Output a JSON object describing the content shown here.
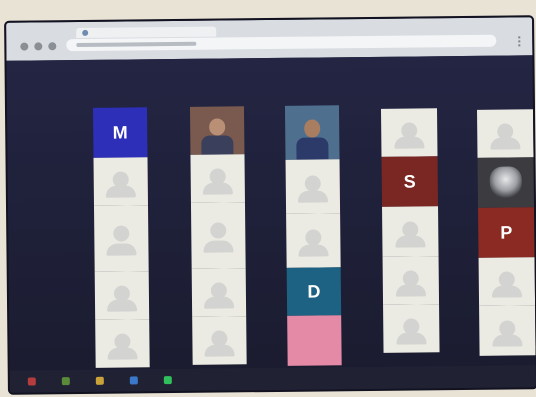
{
  "browser": {
    "tab_icon": "globe-icon",
    "menu_icon": "kebab-menu-icon"
  },
  "meeting": {
    "columns": [
      {
        "id": "col1",
        "tiles": [
          {
            "kind": "initial",
            "label": "M",
            "color": "#2d2fb8"
          },
          {
            "kind": "blank",
            "icon": "person-icon"
          },
          {
            "kind": "blank",
            "icon": "person-icon"
          },
          {
            "kind": "blank",
            "icon": "person-icon"
          },
          {
            "kind": "blank",
            "icon": "person-icon"
          }
        ]
      },
      {
        "id": "col2",
        "tiles": [
          {
            "kind": "photo",
            "icon": "participant-video"
          },
          {
            "kind": "blank",
            "icon": "person-icon"
          },
          {
            "kind": "blank",
            "icon": "person-icon"
          },
          {
            "kind": "blank",
            "icon": "person-icon"
          },
          {
            "kind": "blank",
            "icon": "person-icon"
          }
        ]
      },
      {
        "id": "col3",
        "tiles": [
          {
            "kind": "photo",
            "icon": "participant-video"
          },
          {
            "kind": "blank",
            "icon": "person-icon"
          },
          {
            "kind": "blank",
            "icon": "person-icon"
          },
          {
            "kind": "initial",
            "label": "D",
            "color": "#1e6283"
          },
          {
            "kind": "color",
            "color": "#e58aa6"
          }
        ]
      },
      {
        "id": "col4",
        "tiles": [
          {
            "kind": "blank",
            "icon": "person-icon"
          },
          {
            "kind": "initial",
            "label": "S",
            "color": "#7a2623"
          },
          {
            "kind": "blank",
            "icon": "person-icon"
          },
          {
            "kind": "blank",
            "icon": "person-icon"
          },
          {
            "kind": "blank",
            "icon": "person-icon"
          }
        ]
      },
      {
        "id": "col5",
        "tiles": [
          {
            "kind": "blank",
            "icon": "person-icon"
          },
          {
            "kind": "wolf",
            "icon": "wolf-avatar-icon"
          },
          {
            "kind": "initial",
            "label": "P",
            "color": "#8a2a22"
          },
          {
            "kind": "blank",
            "icon": "person-icon"
          },
          {
            "kind": "blank",
            "icon": "person-icon"
          }
        ]
      }
    ]
  },
  "taskbar": {
    "icons": [
      {
        "name": "start-icon",
        "color": "#b33c3c"
      },
      {
        "name": "app-icon",
        "color": "#5b8a3a"
      },
      {
        "name": "app-icon",
        "color": "#c9a33a"
      },
      {
        "name": "app-icon",
        "color": "#3a78c9"
      },
      {
        "name": "app-icon",
        "color": "#2fbf5b"
      }
    ]
  }
}
